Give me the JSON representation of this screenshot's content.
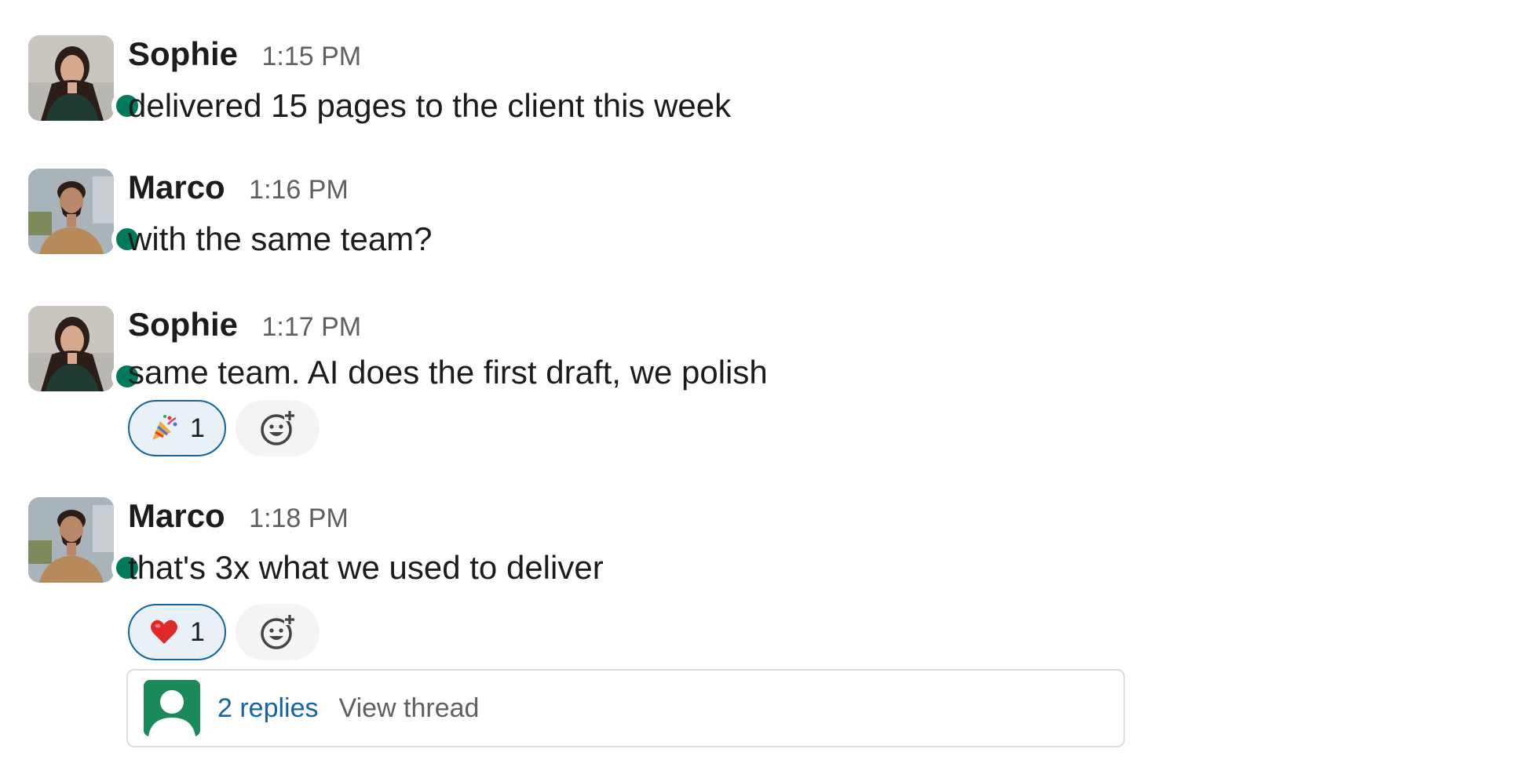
{
  "colors": {
    "presence": "#007a5a",
    "link": "#1264a3",
    "reaction_bg": "#e8f0f8",
    "reaction_border": "#1264a3",
    "text": "#1d1c1d",
    "muted": "#616061"
  },
  "messages": [
    {
      "author": "Sophie",
      "time": "1:15 PM",
      "text": "delivered 15 pages to the client this week",
      "avatar_icon": "sophie-avatar",
      "online": true
    },
    {
      "author": "Marco",
      "time": "1:16 PM",
      "text": "with the same team?",
      "avatar_icon": "marco-avatar",
      "online": true
    },
    {
      "author": "Sophie",
      "time": "1:17 PM",
      "text": "same team. AI does the first draft, we polish",
      "avatar_icon": "sophie-avatar",
      "online": true,
      "reactions": [
        {
          "emoji": "party-popper-icon",
          "count": "1"
        }
      ]
    },
    {
      "author": "Marco",
      "time": "1:18 PM",
      "text": "that's 3x what we used to deliver",
      "avatar_icon": "marco-avatar",
      "online": true,
      "reactions": [
        {
          "emoji": "red-heart-icon",
          "count": "1"
        }
      ],
      "thread": {
        "replies": "2 replies",
        "view": "View thread",
        "avatar_icon": "generic-user-avatar"
      }
    }
  ]
}
